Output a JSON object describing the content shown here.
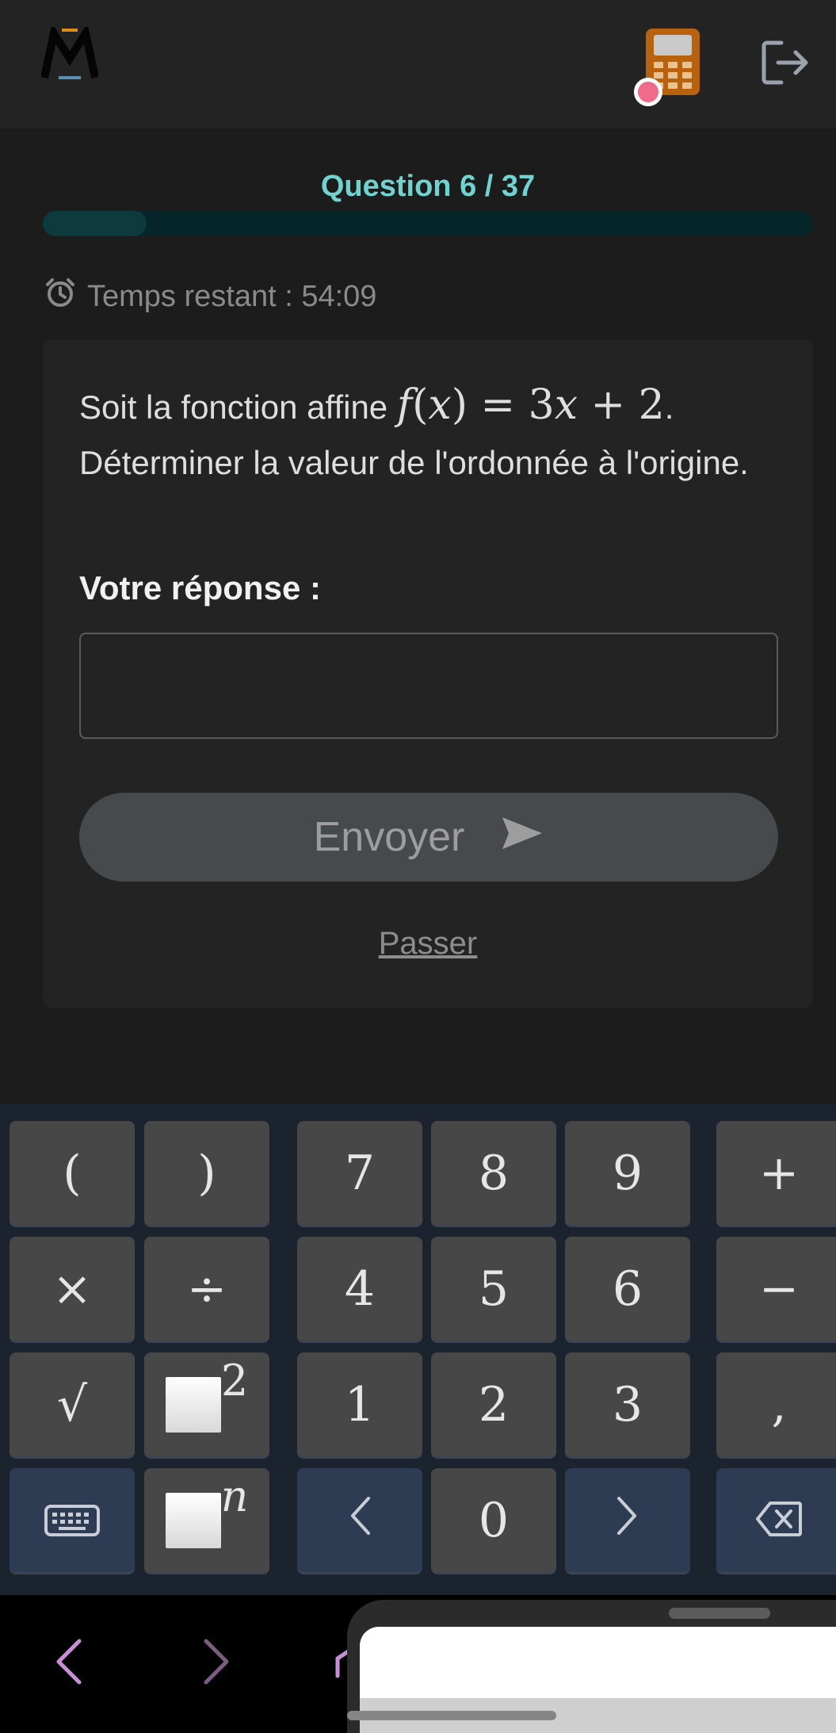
{
  "header": {
    "logo_icon": "m-logo-icon",
    "calculator_icon": "calculator-icon",
    "logout_icon": "logout-icon"
  },
  "quiz": {
    "counter": "Question 6 / 37",
    "progress_fraction": 0.135,
    "timer_label": "Temps restant : 54:09"
  },
  "question": {
    "prefix": "Soit la fonction affine ",
    "suffix": ". Déterminer la valeur de l'ordonnée à l'origine."
  },
  "answer": {
    "label": "Votre réponse :",
    "value": "",
    "placeholder": ""
  },
  "actions": {
    "send_label": "Envoyer",
    "skip_label": "Passer"
  },
  "keypad": {
    "row1": [
      "(",
      ")",
      "7",
      "8",
      "9",
      "+"
    ],
    "row2": [
      "×",
      "÷",
      "4",
      "5",
      "6",
      "−"
    ],
    "row3": [
      "√",
      "2",
      "1",
      "2",
      "3",
      ","
    ],
    "row4": [
      "keyboard-icon",
      "n",
      "left-arrow-icon",
      "0",
      "right-arrow-icon",
      "backspace-icon"
    ]
  },
  "colors": {
    "accent": "#6fd3cf",
    "background": "#1c1c1c",
    "card": "#232323",
    "keypad_bg": "#1b232e",
    "notification_dot": "#f06b8a"
  }
}
